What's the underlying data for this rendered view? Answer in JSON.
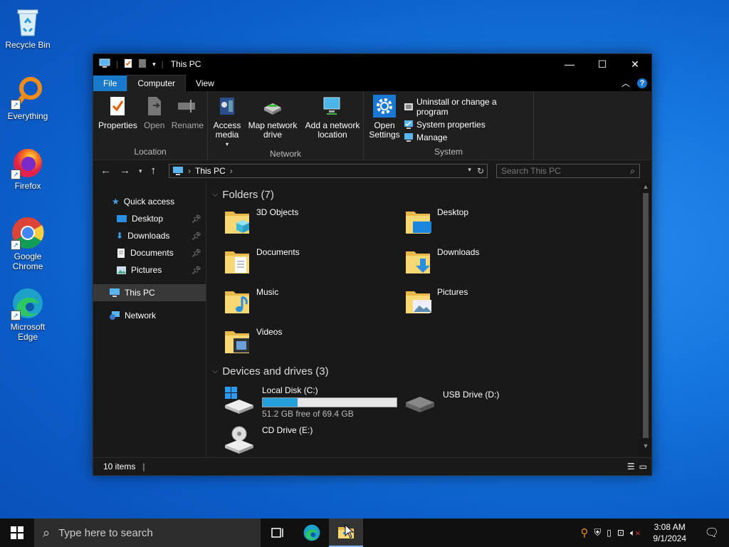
{
  "desktop": {
    "icons": [
      {
        "label": "Recycle Bin"
      },
      {
        "label": "Everything"
      },
      {
        "label": "Firefox"
      },
      {
        "label": "Google Chrome"
      },
      {
        "label": "Microsoft Edge"
      }
    ]
  },
  "window": {
    "title": "This PC",
    "tabs": {
      "file": "File",
      "computer": "Computer",
      "view": "View"
    },
    "ribbon": {
      "location": {
        "name": "Location",
        "properties": "Properties",
        "open": "Open",
        "rename": "Rename"
      },
      "network": {
        "name": "Network",
        "access_media": "Access media",
        "map_drive": "Map network drive",
        "add_location": "Add a network location"
      },
      "system": {
        "name": "System",
        "open_settings": "Open Settings",
        "uninstall": "Uninstall or change a program",
        "sys_props": "System properties",
        "manage": "Manage"
      }
    },
    "address": {
      "path": "This PC",
      "search_placeholder": "Search This PC"
    },
    "nav_pane": {
      "quick_access": "Quick access",
      "desktop": "Desktop",
      "downloads": "Downloads",
      "documents": "Documents",
      "pictures": "Pictures",
      "this_pc": "This PC",
      "network": "Network"
    },
    "folders_header": "Folders (7)",
    "folders": [
      "3D Objects",
      "Desktop",
      "Documents",
      "Downloads",
      "Music",
      "Pictures",
      "Videos"
    ],
    "drives_header": "Devices and drives (3)",
    "drives": {
      "c": {
        "name": "Local Disk (C:)",
        "free": "51.2 GB free of 69.4 GB",
        "used_fraction": 0.26
      },
      "d": {
        "name": "USB Drive (D:)"
      },
      "e": {
        "name": "CD Drive (E:)"
      }
    },
    "status": "10 items"
  },
  "taskbar": {
    "search_placeholder": "Type here to search",
    "time": "3:08 AM",
    "date": "9/1/2024"
  },
  "colors": {
    "accent": "#1979ca",
    "progress": "#26a0da"
  }
}
